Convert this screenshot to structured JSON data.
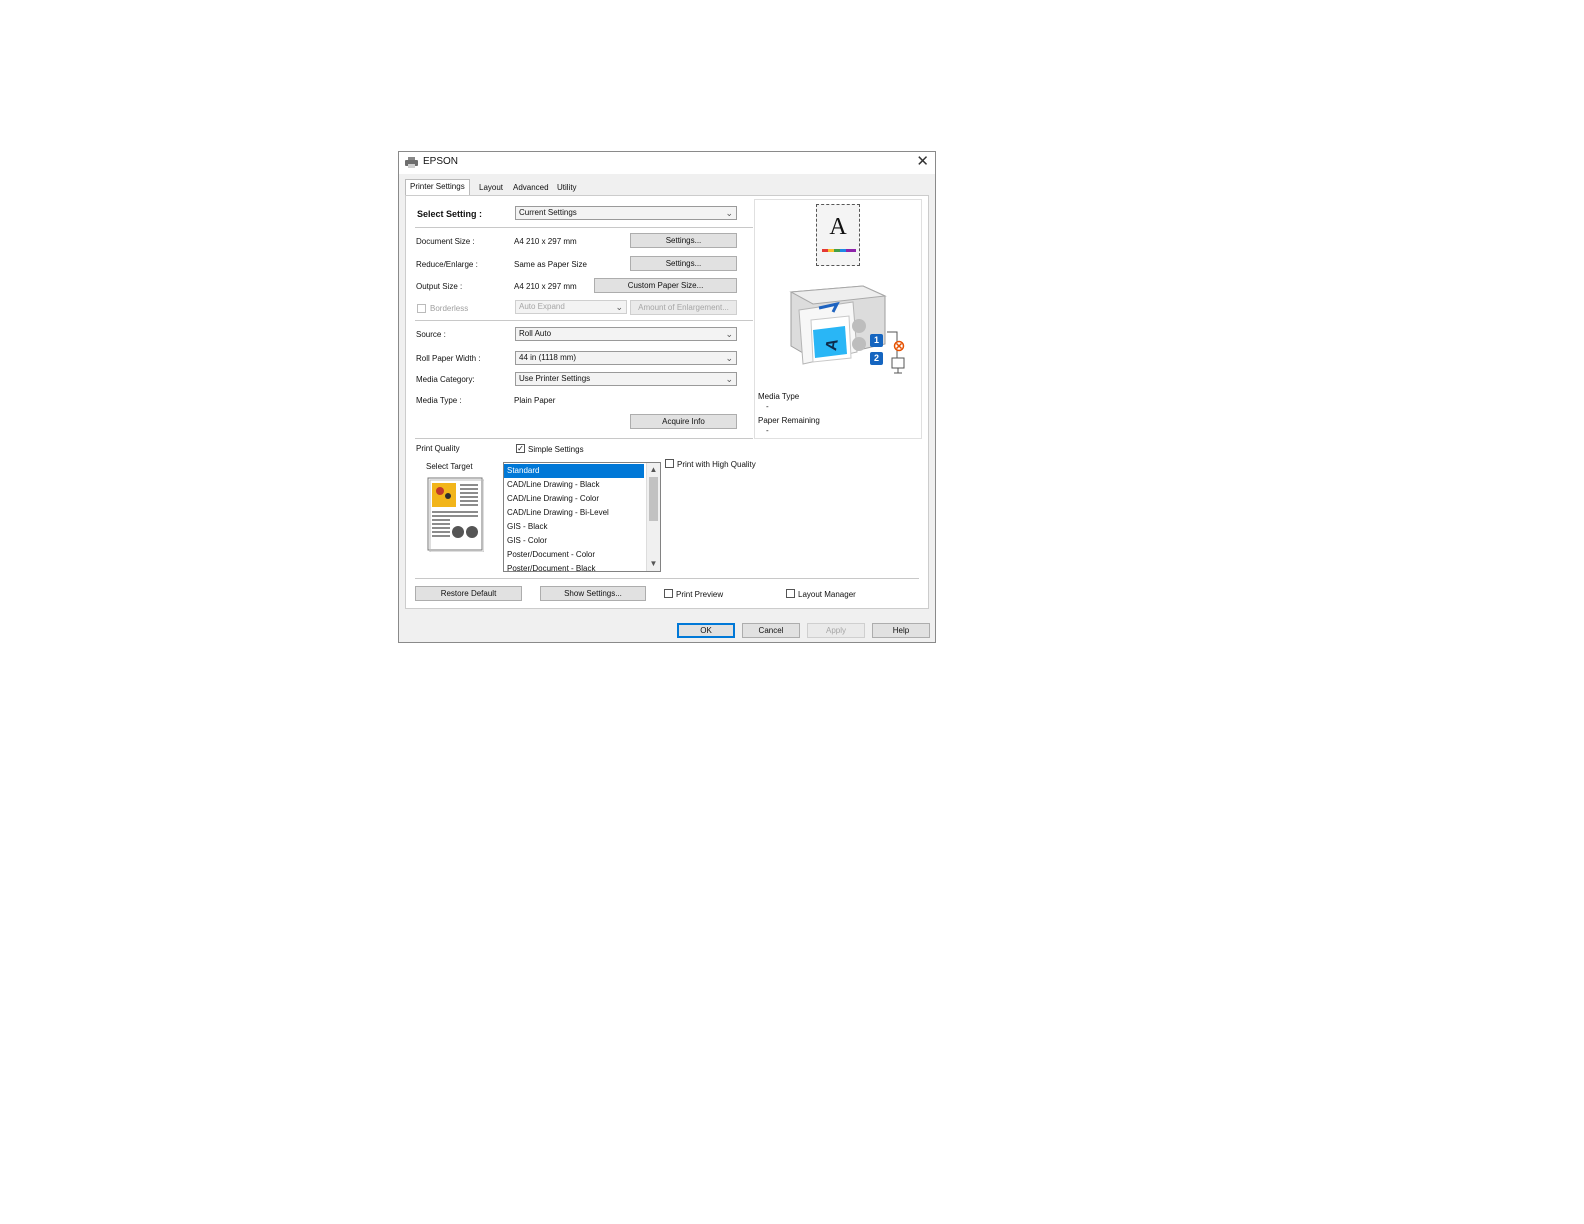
{
  "window": {
    "title": "EPSON",
    "close_glyph": "✕"
  },
  "tabs": [
    {
      "label": "Printer Settings",
      "active": true
    },
    {
      "label": "Layout"
    },
    {
      "label": "Advanced"
    },
    {
      "label": "Utility"
    }
  ],
  "settings": {
    "select_setting": {
      "label": "Select Setting :",
      "value": "Current Settings"
    },
    "document_size": {
      "label": "Document Size :",
      "value": "A4 210 x 297 mm",
      "button": "Settings..."
    },
    "reduce_enlarge": {
      "label": "Reduce/Enlarge :",
      "value": "Same as Paper Size",
      "button": "Settings..."
    },
    "output_size": {
      "label": "Output Size :",
      "value": "A4 210 x 297 mm",
      "button": "Custom Paper Size..."
    },
    "borderless": {
      "label": "Borderless",
      "mode": "Auto Expand",
      "button": "Amount of Enlargement...",
      "checked": false,
      "enabled": false
    },
    "source": {
      "label": "Source :",
      "value": "Roll Auto"
    },
    "roll_paper_width": {
      "label": "Roll Paper Width :",
      "value": "44 in (1118 mm)"
    },
    "media_category": {
      "label": "Media Category:",
      "value": "Use Printer Settings"
    },
    "media_type": {
      "label": "Media Type :",
      "value": "Plain Paper"
    },
    "acquire_info_button": "Acquire Info"
  },
  "preview": {
    "paper_letter": "A",
    "media_type_label": "Media Type",
    "media_type_value": "-",
    "paper_remaining_label": "Paper Remaining",
    "paper_remaining_value": "-",
    "roll_badges": [
      "1",
      "2"
    ]
  },
  "print_quality": {
    "label": "Print Quality",
    "simple_settings": {
      "label": "Simple Settings",
      "checked": true
    },
    "select_target_label": "Select Target",
    "targets": [
      "Standard",
      "CAD/Line Drawing - Black",
      "CAD/Line Drawing - Color",
      "CAD/Line Drawing - Bi-Level",
      "GIS - Black",
      "GIS - Color",
      "Poster/Document - Color",
      "Poster/Document - Black"
    ],
    "selected_target": "Standard",
    "high_quality": {
      "label": "Print with High Quality",
      "checked": false
    }
  },
  "bottom_bar": {
    "restore_default": "Restore Default",
    "show_settings": "Show Settings...",
    "print_preview": {
      "label": "Print Preview",
      "checked": false
    },
    "layout_manager": {
      "label": "Layout Manager",
      "checked": false
    }
  },
  "dialog_buttons": {
    "ok": "OK",
    "cancel": "Cancel",
    "apply": "Apply",
    "help": "Help"
  },
  "colors": {
    "accent": "#0078d7",
    "badge_blue": "#1565c0",
    "target_yellow": "#f2b51a"
  }
}
